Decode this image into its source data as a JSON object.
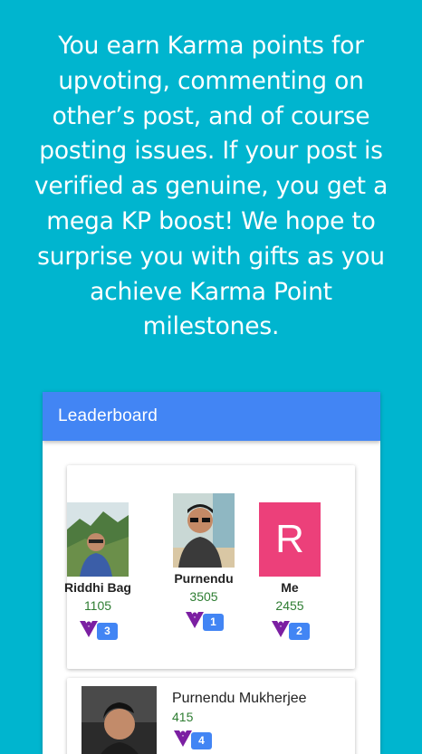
{
  "intro": {
    "text": "You earn Karma points for upvoting, commenting on other’s post, and of course posting issues. If your post is verified as genuine, you get a mega KP boost! We hope to surprise you with gifts as you achieve Karma Point milestones."
  },
  "leaderboard": {
    "title": "Leaderboard",
    "podium": [
      {
        "name": "Riddhi Bag",
        "score": "1105",
        "rank": "3"
      },
      {
        "name": "Purnendu",
        "score": "3505",
        "rank": "1"
      },
      {
        "name": "Me",
        "score": "2455",
        "rank": "2",
        "initial": "R"
      }
    ],
    "list": [
      {
        "name": "Purnendu Mukherjee",
        "score": "415",
        "rank": "4"
      }
    ]
  },
  "colors": {
    "background": "#00b5cf",
    "header": "#4285f4",
    "rank_badge": "#4285f4",
    "score": "#2e7d32",
    "avatar_initial_bg": "#ec407a",
    "karma_icon": "#7b1fa2"
  },
  "icons": {
    "karma": "karma-points-icon"
  }
}
